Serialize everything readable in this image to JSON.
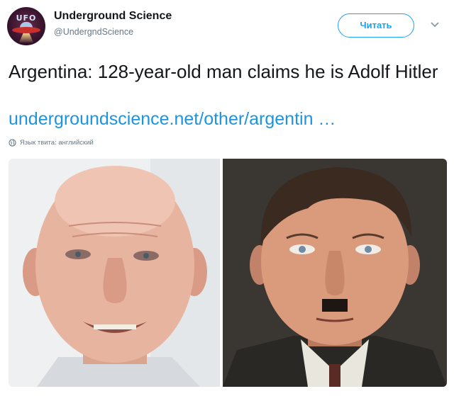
{
  "account": {
    "name": "Underground Science",
    "handle": "@UndergndScience",
    "avatar_icon": "ufo-logo-icon",
    "avatar_text": "UFO"
  },
  "follow_button": {
    "label": "Читать",
    "color": "#1da1f2"
  },
  "menu_icon": "chevron-down-icon",
  "tweet": {
    "text": "Argentina: 128-year-old man claims he is Adolf Hitler",
    "link": "undergroundscience.net/other/argentin …",
    "link_color": "#1b95e0"
  },
  "language_note": {
    "icon": "globe-icon",
    "text": "Язык твита: английский"
  },
  "media": [
    {
      "name": "photo-elderly-man",
      "description_icon": "portrait-photo"
    },
    {
      "name": "photo-historical-portrait",
      "description_icon": "portrait-photo"
    }
  ]
}
